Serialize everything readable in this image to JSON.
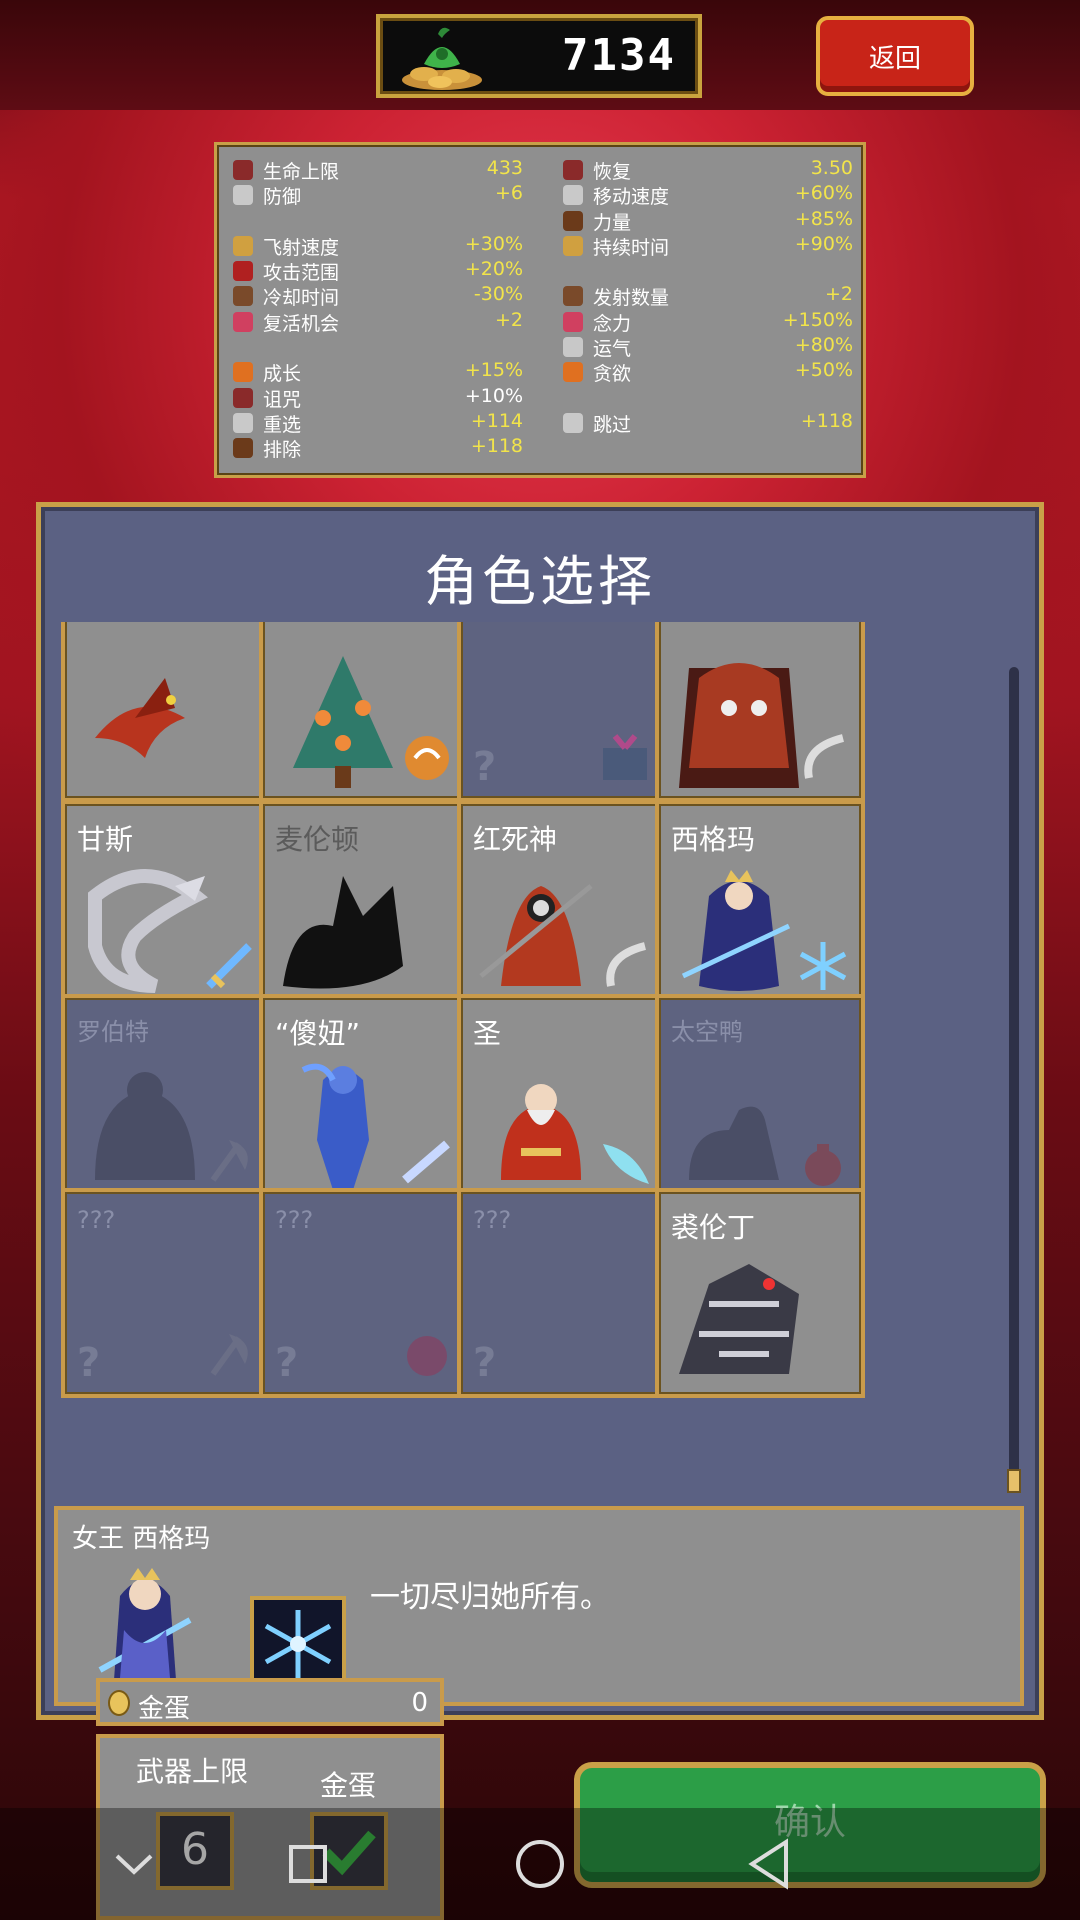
{
  "header": {
    "coins": "7134",
    "back_label": "返回"
  },
  "stats": {
    "left": [
      {
        "icon": "heart-icon",
        "label": "生命上限",
        "value": "433",
        "white": false
      },
      {
        "icon": "armor-icon",
        "label": "防御",
        "value": "+6",
        "white": false
      },
      {
        "icon": "",
        "label": "",
        "value": "",
        "white": false
      },
      {
        "icon": "projectile-speed-icon",
        "label": "飞射速度",
        "value": "+30%",
        "white": false
      },
      {
        "icon": "area-icon",
        "label": "攻击范围",
        "value": "+20%",
        "white": false
      },
      {
        "icon": "cooldown-icon",
        "label": "冷却时间",
        "value": "-30%",
        "white": false
      },
      {
        "icon": "revival-icon",
        "label": "复活机会",
        "value": "+2",
        "white": false
      },
      {
        "icon": "",
        "label": "",
        "value": "",
        "white": false
      },
      {
        "icon": "growth-icon",
        "label": "成长",
        "value": "+15%",
        "white": false
      },
      {
        "icon": "curse-icon",
        "label": "诅咒",
        "value": "+10%",
        "white": true
      },
      {
        "icon": "reroll-icon",
        "label": "重选",
        "value": "+114",
        "white": false
      },
      {
        "icon": "banish-icon",
        "label": "排除",
        "value": "+118",
        "white": false
      }
    ],
    "right": [
      {
        "icon": "recovery-icon",
        "label": "恢复",
        "value": "3.50",
        "white": false
      },
      {
        "icon": "wing-icon",
        "label": "移动速度",
        "value": "+60%",
        "white": false
      },
      {
        "icon": "might-icon",
        "label": "力量",
        "value": "+85%",
        "white": false
      },
      {
        "icon": "duration-icon",
        "label": "持续时间",
        "value": "+90%",
        "white": false
      },
      {
        "icon": "",
        "label": "",
        "value": "",
        "white": false
      },
      {
        "icon": "amount-icon",
        "label": "发射数量",
        "value": "+2",
        "white": false
      },
      {
        "icon": "magnet-icon",
        "label": "念力",
        "value": "+150%",
        "white": false
      },
      {
        "icon": "luck-icon",
        "label": "运气",
        "value": "+80%",
        "white": false
      },
      {
        "icon": "greed-icon",
        "label": "贪欲",
        "value": "+50%",
        "white": false
      },
      {
        "icon": "",
        "label": "",
        "value": "",
        "white": false
      },
      {
        "icon": "skip-icon",
        "label": "跳过",
        "value": "+118",
        "white": false
      }
    ]
  },
  "panel": {
    "title": "角色选择"
  },
  "characters": {
    "row0": [
      {
        "name": "",
        "state": "unlocked",
        "art": "phoenix",
        "wpn": "none"
      },
      {
        "name": "",
        "state": "unlocked",
        "art": "tree",
        "wpn": "orb"
      },
      {
        "name": "",
        "state": "locked",
        "art": "none",
        "wpn": "gift"
      },
      {
        "name": "",
        "state": "unlocked",
        "art": "reaper-group",
        "wpn": "scythe"
      }
    ],
    "row1": [
      {
        "name": "甘斯",
        "state": "unlocked",
        "art": "serpent",
        "wpn": "sword"
      },
      {
        "name": "麦伦顿",
        "state": "faded",
        "art": "silhouette-dragon",
        "wpn": "none"
      },
      {
        "name": "红死神",
        "state": "unlocked",
        "art": "reaper",
        "wpn": "scythe"
      },
      {
        "name": "西格玛",
        "state": "unlocked",
        "art": "queen",
        "wpn": "snowflake"
      }
    ],
    "row2": [
      {
        "name": "罗伯特",
        "state": "locked",
        "art": "silhouette",
        "wpn": "axe"
      },
      {
        "name": "“傻妞”",
        "state": "unlocked",
        "art": "blue-figure",
        "wpn": "pistol"
      },
      {
        "name": "圣",
        "state": "unlocked",
        "art": "santa",
        "wpn": "feather"
      },
      {
        "name": "太空鸭",
        "state": "locked",
        "art": "silhouette-duck",
        "wpn": "bag"
      }
    ],
    "row3": [
      {
        "name": "???",
        "state": "locked",
        "art": "none",
        "wpn": "axe"
      },
      {
        "name": "???",
        "state": "locked",
        "art": "none",
        "wpn": "rose"
      },
      {
        "name": "???",
        "state": "locked",
        "art": "none",
        "wpn": "none"
      },
      {
        "name": "裘伦丁",
        "state": "unlocked",
        "art": "mech-dragon",
        "wpn": "none"
      }
    ]
  },
  "detail": {
    "name": "女王  西格玛",
    "quote": "一切尽归她所有。"
  },
  "egg": {
    "label": "金蛋",
    "count": "0"
  },
  "options": {
    "weapon_limit_label": "武器上限",
    "weapon_limit_value": "6",
    "egg_label": "金蛋"
  },
  "confirm_label": "确认",
  "question_mark": "?",
  "colors": {
    "gold": "#c9a048",
    "stat_value": "#f2e44a",
    "panel": "#5b6183",
    "confirm": "#2c9e47",
    "back": "#c82418"
  }
}
